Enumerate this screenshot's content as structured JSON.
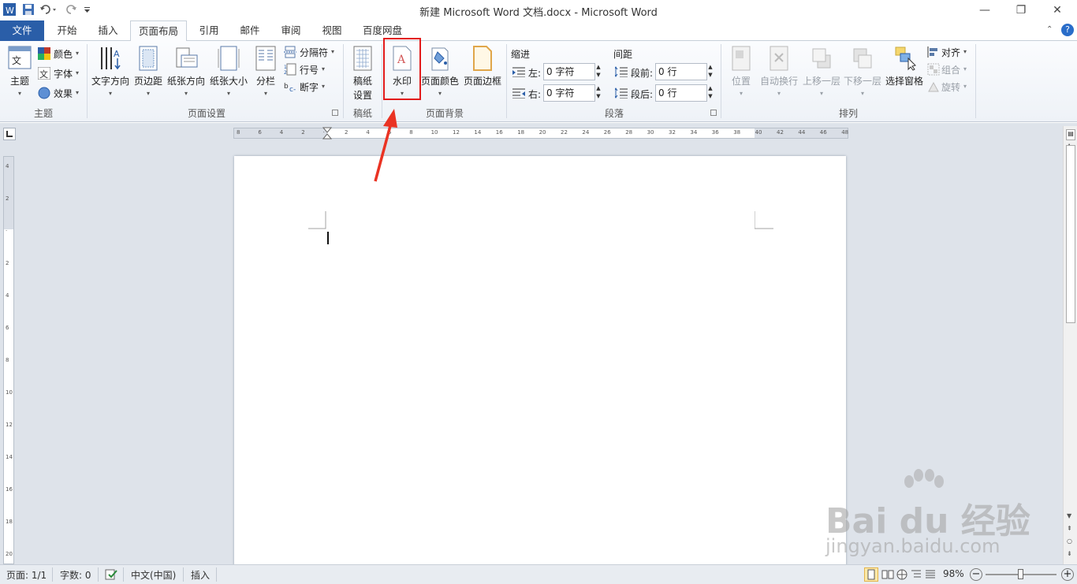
{
  "window": {
    "title": "新建 Microsoft Word 文档.docx  -  Microsoft Word",
    "controls": [
      "—",
      "❐",
      "✕"
    ]
  },
  "tabs": [
    {
      "label": "文件"
    },
    {
      "label": "开始"
    },
    {
      "label": "插入"
    },
    {
      "label": "页面布局"
    },
    {
      "label": "引用"
    },
    {
      "label": "邮件"
    },
    {
      "label": "审阅"
    },
    {
      "label": "视图"
    },
    {
      "label": "百度网盘"
    }
  ],
  "ribbon": {
    "theme_group": {
      "label": "主题",
      "theme_button": "主题",
      "colors": "颜色",
      "fonts": "字体",
      "effects": "效果"
    },
    "page_setup_group": {
      "label": "页面设置",
      "text_direction": "文字方向",
      "margins": "页边距",
      "orientation": "纸张方向",
      "size": "纸张大小",
      "columns": "分栏",
      "breaks": "分隔符",
      "line_numbers": "行号",
      "hyphenation": "断字"
    },
    "manuscript_group": {
      "label": "稿纸",
      "button_line1": "稿纸",
      "button_line2": "设置"
    },
    "page_background_group": {
      "label": "页面背景",
      "watermark": "水印",
      "page_color": "页面颜色",
      "page_borders": "页面边框"
    },
    "paragraph_group": {
      "label": "段落",
      "indent_header": "缩进",
      "spacing_header": "间距",
      "indent_left_label": "左:",
      "indent_left_value": "0 字符",
      "indent_right_label": "右:",
      "indent_right_value": "0 字符",
      "space_before_label": "段前:",
      "space_before_value": "0 行",
      "space_after_label": "段后:",
      "space_after_value": "0 行"
    },
    "arrange_group": {
      "label": "排列",
      "position": "位置",
      "wrap_text": "自动换行",
      "bring_forward": "上移一层",
      "send_backward": "下移一层",
      "selection_pane": "选择窗格",
      "align": "对齐",
      "group": "组合",
      "rotate": "旋转"
    }
  },
  "ruler": {
    "horizontal_ticks": [
      "8",
      "6",
      "4",
      "2",
      "",
      "2",
      "4",
      "6",
      "8",
      "10",
      "12",
      "14",
      "16",
      "18",
      "20",
      "22",
      "24",
      "26",
      "28",
      "30",
      "32",
      "34",
      "36",
      "38",
      "40",
      "42",
      "44",
      "46",
      "48"
    ],
    "vertical_ticks": [
      "4",
      "2",
      "",
      "2",
      "4",
      "6",
      "8",
      "10",
      "12",
      "14",
      "16",
      "18",
      "20"
    ]
  },
  "status": {
    "page": "页面: 1/1",
    "words": "字数: 0",
    "language": "中文(中国)",
    "mode": "插入",
    "zoom": "98%",
    "zoom_level": 0.49
  },
  "watermark": {
    "brand": "Bai du 经验",
    "url": "jingyan.baidu.com"
  },
  "colors": {
    "file_tab": "#2a5ea8",
    "highlight": "#e21b1b"
  }
}
